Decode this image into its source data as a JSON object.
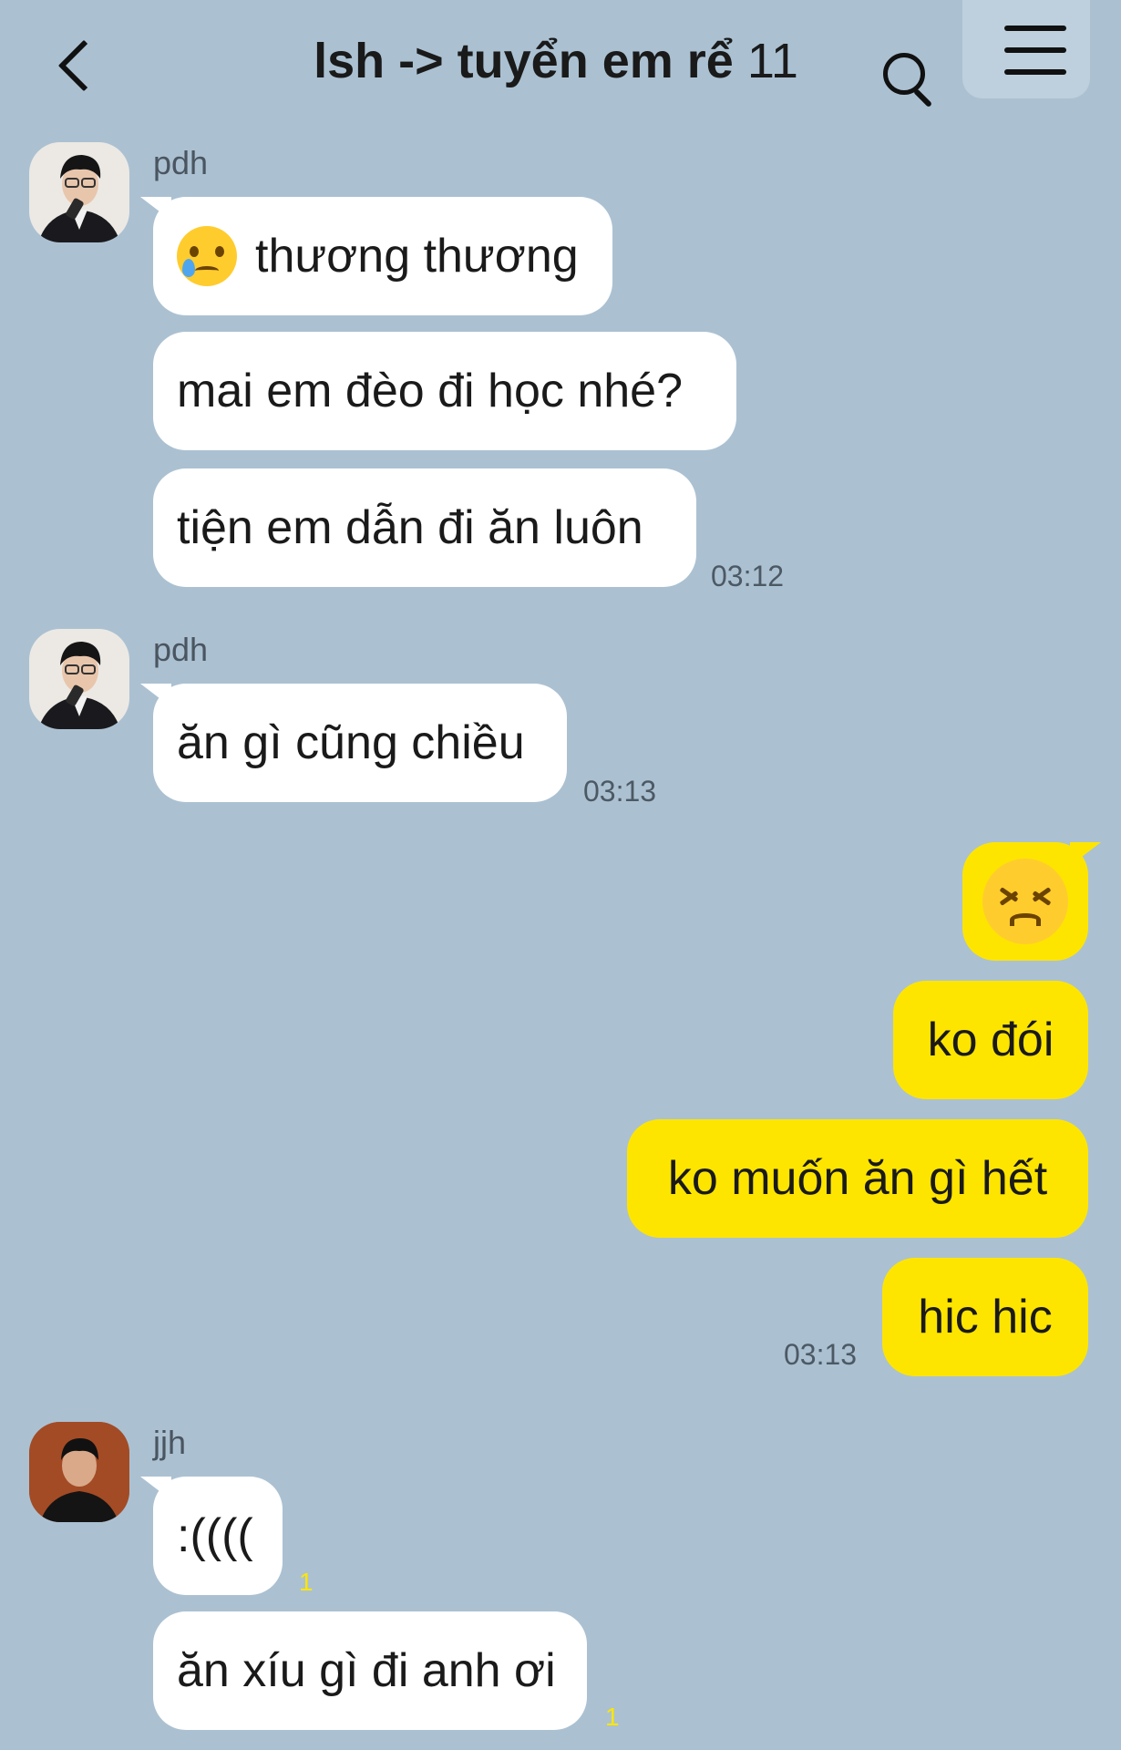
{
  "header": {
    "title": "lsh -> tuyển em rể",
    "member_count": "11"
  },
  "messages": {
    "g1": {
      "sender": "pdh",
      "m1": "thương thương",
      "m2": "mai em đèo đi học nhé?",
      "m3": "tiện em dẫn đi ăn luôn",
      "time": "03:12"
    },
    "g2": {
      "sender": "pdh",
      "m1": "ăn gì cũng chiều",
      "time": "03:13"
    },
    "g3": {
      "m1_emoji": "confounded-face",
      "m2": "ko đói",
      "m3": "ko muốn ăn gì hết",
      "m4": "hic hic",
      "time": "03:13"
    },
    "g4": {
      "sender": "jjh",
      "m1": ":((((",
      "m1_unread": "1",
      "m2": "ăn xíu gì đi anh ơi",
      "m2_unread": "1"
    }
  },
  "colors": {
    "background": "#abc1d2",
    "incoming_bubble": "#ffffff",
    "outgoing_bubble": "#fee500"
  }
}
